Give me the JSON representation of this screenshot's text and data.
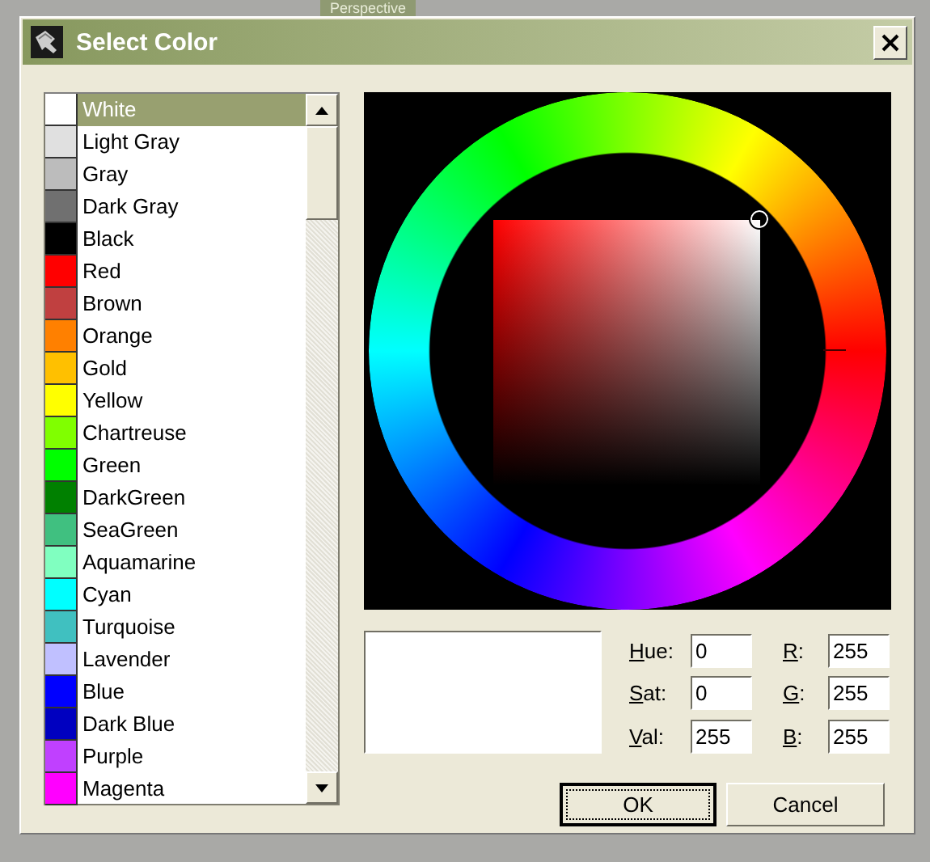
{
  "viewport": {
    "label": "Perspective"
  },
  "window": {
    "title": "Select Color"
  },
  "colors": [
    {
      "name": "White",
      "color": "#ffffff",
      "selected": true
    },
    {
      "name": "Light Gray",
      "color": "#e0e0e0",
      "selected": false
    },
    {
      "name": "Gray",
      "color": "#bcbcbc",
      "selected": false
    },
    {
      "name": "Dark Gray",
      "color": "#707070",
      "selected": false
    },
    {
      "name": "Black",
      "color": "#000000",
      "selected": false
    },
    {
      "name": "Red",
      "color": "#ff0000",
      "selected": false
    },
    {
      "name": "Brown",
      "color": "#c04040",
      "selected": false
    },
    {
      "name": "Orange",
      "color": "#ff8000",
      "selected": false
    },
    {
      "name": "Gold",
      "color": "#ffc000",
      "selected": false
    },
    {
      "name": "Yellow",
      "color": "#ffff00",
      "selected": false
    },
    {
      "name": "Chartreuse",
      "color": "#80ff00",
      "selected": false
    },
    {
      "name": "Green",
      "color": "#00ff00",
      "selected": false
    },
    {
      "name": "DarkGreen",
      "color": "#008000",
      "selected": false
    },
    {
      "name": "SeaGreen",
      "color": "#40c080",
      "selected": false
    },
    {
      "name": "Aquamarine",
      "color": "#80ffc0",
      "selected": false
    },
    {
      "name": "Cyan",
      "color": "#00ffff",
      "selected": false
    },
    {
      "name": "Turquoise",
      "color": "#40c0c0",
      "selected": false
    },
    {
      "name": "Lavender",
      "color": "#c0c0ff",
      "selected": false
    },
    {
      "name": "Blue",
      "color": "#0000ff",
      "selected": false
    },
    {
      "name": "Dark Blue",
      "color": "#0000c0",
      "selected": false
    },
    {
      "name": "Purple",
      "color": "#c040ff",
      "selected": false
    },
    {
      "name": "Magenta",
      "color": "#ff00ff",
      "selected": false
    }
  ],
  "preview": {
    "color": "#ffffff"
  },
  "fields_hsv": [
    {
      "label": "Hue:",
      "value": "0"
    },
    {
      "label": "Sat:",
      "value": "0"
    },
    {
      "label": "Val:",
      "value": "255"
    }
  ],
  "fields_rgb": [
    {
      "label": "R:",
      "value": "255"
    },
    {
      "label": "G:",
      "value": "255"
    },
    {
      "label": "B:",
      "value": "255"
    }
  ],
  "buttons": [
    {
      "label": "OK",
      "default": true
    },
    {
      "label": "Cancel",
      "default": false
    }
  ]
}
